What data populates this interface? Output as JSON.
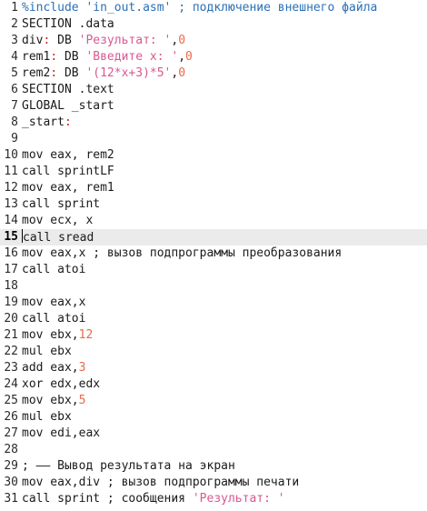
{
  "editor": {
    "current_line": 15,
    "lines": [
      {
        "n": "1",
        "segs": [
          {
            "t": "%include ",
            "c": "com"
          },
          {
            "t": "'in_out.asm'",
            "c": "com"
          },
          {
            "t": " ; подключение внешнего файла",
            "c": "com"
          }
        ]
      },
      {
        "n": "2",
        "segs": [
          {
            "t": "SECTION .data",
            "c": ""
          }
        ]
      },
      {
        "n": "3",
        "segs": [
          {
            "t": "div",
            "c": ""
          },
          {
            "t": ":",
            "c": "lbl"
          },
          {
            "t": " DB ",
            "c": ""
          },
          {
            "t": "'Результат: '",
            "c": "str"
          },
          {
            "t": ",",
            "c": ""
          },
          {
            "t": "0",
            "c": "num"
          }
        ]
      },
      {
        "n": "4",
        "segs": [
          {
            "t": "rem1",
            "c": ""
          },
          {
            "t": ":",
            "c": "lbl"
          },
          {
            "t": " DB ",
            "c": ""
          },
          {
            "t": "'Введите x: '",
            "c": "str"
          },
          {
            "t": ",",
            "c": ""
          },
          {
            "t": "0",
            "c": "num"
          }
        ]
      },
      {
        "n": "5",
        "segs": [
          {
            "t": "rem2",
            "c": ""
          },
          {
            "t": ":",
            "c": "lbl"
          },
          {
            "t": " DB ",
            "c": ""
          },
          {
            "t": "'(12*x+3)*5'",
            "c": "str"
          },
          {
            "t": ",",
            "c": ""
          },
          {
            "t": "0",
            "c": "num"
          }
        ]
      },
      {
        "n": "6",
        "segs": [
          {
            "t": "SECTION .text",
            "c": ""
          }
        ]
      },
      {
        "n": "7",
        "segs": [
          {
            "t": "GLOBAL _start",
            "c": ""
          }
        ]
      },
      {
        "n": "8",
        "segs": [
          {
            "t": "_start",
            "c": ""
          },
          {
            "t": ":",
            "c": "lbl"
          }
        ]
      },
      {
        "n": "9",
        "segs": []
      },
      {
        "n": "10",
        "segs": [
          {
            "t": "mov eax, rem2",
            "c": ""
          }
        ]
      },
      {
        "n": "11",
        "segs": [
          {
            "t": "call sprintLF",
            "c": ""
          }
        ]
      },
      {
        "n": "12",
        "segs": [
          {
            "t": "mov eax, rem1",
            "c": ""
          }
        ]
      },
      {
        "n": "13",
        "segs": [
          {
            "t": "call sprint",
            "c": ""
          }
        ]
      },
      {
        "n": "14",
        "segs": [
          {
            "t": "mov ecx, x",
            "c": ""
          }
        ]
      },
      {
        "n": "15",
        "segs": [
          {
            "t": "call sread",
            "c": ""
          }
        ]
      },
      {
        "n": "16",
        "segs": [
          {
            "t": "mov eax,x ; вызов подпрограммы преобразования",
            "c": ""
          }
        ]
      },
      {
        "n": "17",
        "segs": [
          {
            "t": "call atoi",
            "c": ""
          }
        ]
      },
      {
        "n": "18",
        "segs": []
      },
      {
        "n": "19",
        "segs": [
          {
            "t": "mov eax,x",
            "c": ""
          }
        ]
      },
      {
        "n": "20",
        "segs": [
          {
            "t": "call atoi",
            "c": ""
          }
        ]
      },
      {
        "n": "21",
        "segs": [
          {
            "t": "mov ebx,",
            "c": ""
          },
          {
            "t": "12",
            "c": "num"
          }
        ]
      },
      {
        "n": "22",
        "segs": [
          {
            "t": "mul ebx",
            "c": ""
          }
        ]
      },
      {
        "n": "23",
        "segs": [
          {
            "t": "add eax,",
            "c": ""
          },
          {
            "t": "3",
            "c": "num"
          }
        ]
      },
      {
        "n": "24",
        "segs": [
          {
            "t": "xor edx,edx",
            "c": ""
          }
        ]
      },
      {
        "n": "25",
        "segs": [
          {
            "t": "mov ebx,",
            "c": ""
          },
          {
            "t": "5",
            "c": "num"
          }
        ]
      },
      {
        "n": "26",
        "segs": [
          {
            "t": "mul ebx",
            "c": ""
          }
        ]
      },
      {
        "n": "27",
        "segs": [
          {
            "t": "mov edi,eax",
            "c": ""
          }
        ]
      },
      {
        "n": "28",
        "segs": []
      },
      {
        "n": "29",
        "segs": [
          {
            "t": "; —— Вывод результата на экран",
            "c": ""
          }
        ]
      },
      {
        "n": "30",
        "segs": [
          {
            "t": "mov eax,div ; вызов подпрограммы печати",
            "c": ""
          }
        ]
      },
      {
        "n": "31",
        "segs": [
          {
            "t": "call sprint ; сообщения ",
            "c": ""
          },
          {
            "t": "'Результат: '",
            "c": "str"
          }
        ]
      }
    ]
  }
}
